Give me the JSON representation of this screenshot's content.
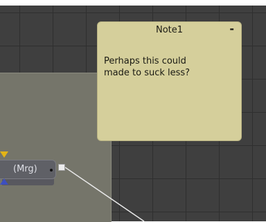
{
  "note": {
    "title": "Note1",
    "minimize_symbol": "-",
    "body": "Perhaps this could\nmade to suck less?"
  },
  "node": {
    "label": "(Mrg)"
  },
  "colors": {
    "canvas": "#3f3f3f",
    "note_background": "#d5cf9b",
    "underlay": "#75756a",
    "node": "#5f6066",
    "input_yellow": "#e3b416",
    "input_blue": "#3d4fbf",
    "connection": "#e8e8e8"
  }
}
